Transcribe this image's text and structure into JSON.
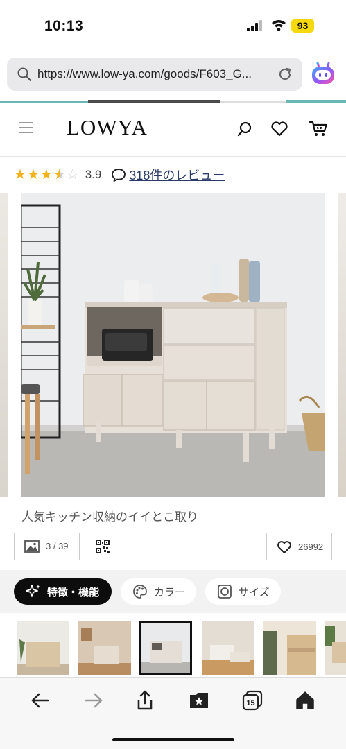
{
  "status_bar": {
    "time": "10:13",
    "battery": "93"
  },
  "browser": {
    "url": "https://www.low-ya.com/goods/F603_G..."
  },
  "site": {
    "logo": "LOWYA"
  },
  "product": {
    "rating_value": "3.9",
    "rating_stars": 3.5,
    "reviews_link": "318件のレビュー",
    "image_caption": "人気キッチン収納のイイとこ取り",
    "image_counter": "3 / 39",
    "favorite_count": "26992"
  },
  "tabs": [
    {
      "label": "特徴・機能",
      "active": true
    },
    {
      "label": "カラー",
      "active": false
    },
    {
      "label": "サイズ",
      "active": false
    }
  ],
  "colors": {
    "star": "#f2b21b",
    "link": "#2a3b6a",
    "active_tab": "#0d0d0d"
  }
}
